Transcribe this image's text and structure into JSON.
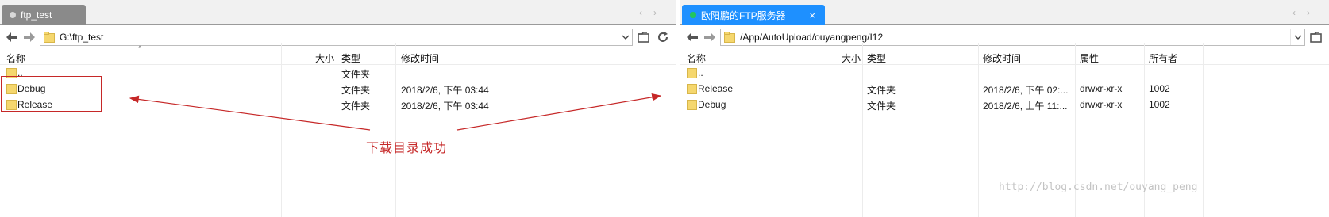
{
  "left": {
    "tab": {
      "title": "ftp_test"
    },
    "path": "G:\\ftp_test",
    "columns": {
      "name": "名称",
      "size": "大小",
      "type": "类型",
      "modified": "修改时间"
    },
    "rows": [
      {
        "name": "..",
        "size": "",
        "type": "文件夹",
        "modified": ""
      },
      {
        "name": "Debug",
        "size": "",
        "type": "文件夹",
        "modified": "2018/2/6, 下午 03:44"
      },
      {
        "name": "Release",
        "size": "",
        "type": "文件夹",
        "modified": "2018/2/6, 下午 03:44"
      }
    ]
  },
  "right": {
    "tab": {
      "title": "欧阳鹏的FTP服务器",
      "close": "×"
    },
    "path": "/App/AutoUpload/ouyangpeng/I12",
    "columns": {
      "name": "名称",
      "size": "大小",
      "type": "类型",
      "modified": "修改时间",
      "attributes": "属性",
      "owner": "所有者"
    },
    "rows": [
      {
        "name": "..",
        "size": "",
        "type": "",
        "modified": "",
        "attributes": "",
        "owner": ""
      },
      {
        "name": "Release",
        "size": "",
        "type": "文件夹",
        "modified": "2018/2/6, 下午 02:...",
        "attributes": "drwxr-xr-x",
        "owner": "1002"
      },
      {
        "name": "Debug",
        "size": "",
        "type": "文件夹",
        "modified": "2018/2/6, 上午 11:...",
        "attributes": "drwxr-xr-x",
        "owner": "1002"
      }
    ]
  },
  "annotation": {
    "text": "下载目录成功",
    "color": "#c62828"
  },
  "watermark": "http://blog.csdn.net/ouyang_peng",
  "colors": {
    "right_tab": "#1e90ff",
    "left_tab": "#8a8a8a",
    "folder": "#f5d76e",
    "connected": "#22c55e"
  },
  "icons": [
    "back-arrow-icon",
    "forward-arrow-icon",
    "folder-icon",
    "chevron-down-icon",
    "new-folder-icon",
    "refresh-icon",
    "close-icon",
    "tab-scroll-left-icon",
    "tab-scroll-right-icon",
    "sort-ascending-icon"
  ]
}
